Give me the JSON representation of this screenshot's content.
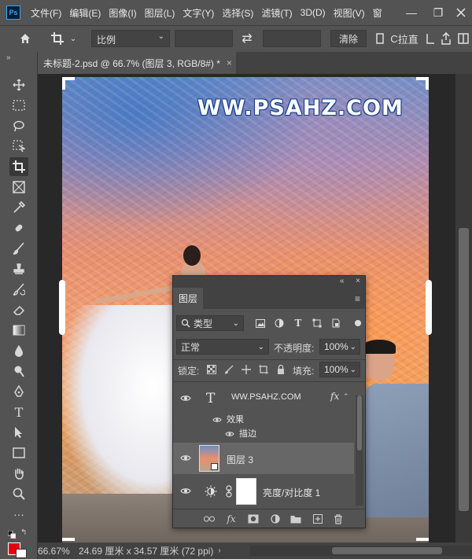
{
  "app": {
    "logo": "Ps"
  },
  "menu": [
    "文件(F)",
    "编辑(E)",
    "图像(I)",
    "图层(L)",
    "文字(Y)",
    "选择(S)",
    "滤镜(T)",
    "3D(D)",
    "视图(V)",
    "窗"
  ],
  "window_controls": {
    "minimize": "—",
    "restore": "❐"
  },
  "options": {
    "home_icon": "home-icon",
    "crop_tool_icon": "crop-icon",
    "ratio_select": "比例",
    "swap_icon": "⇄",
    "clear_button": "清除",
    "straighten_label": "拉直"
  },
  "document": {
    "tab_title": "未标题-2.psd @ 66.7% (图层 3, RGB/8#) *",
    "close": "×"
  },
  "canvas": {
    "watermark": "WW.PSAHZ.COM"
  },
  "status": {
    "zoom": "66.67%",
    "doc_size": "24.69 厘米 x 34.57 厘米 (72 ppi)"
  },
  "colors": {
    "foreground": "#e60012",
    "background": "#ffffff"
  },
  "layers_panel": {
    "collapse": "«",
    "close": "×",
    "tab": "图层",
    "menu_icon": "≡",
    "filter_select": "类型",
    "blend_mode": "正常",
    "opacity_label": "不透明度:",
    "opacity_value": "100%",
    "lock_label": "锁定:",
    "fill_label": "填充:",
    "fill_value": "100%",
    "layers": [
      {
        "name": "WW.PSAHZ.COM",
        "type": "text",
        "fx": "fx"
      },
      {
        "name": "图层 3",
        "type": "smart-object",
        "selected": true
      },
      {
        "name": "亮度/对比度 1",
        "type": "adjustment"
      }
    ],
    "effects_label": "效果",
    "stroke_label": "描边"
  }
}
